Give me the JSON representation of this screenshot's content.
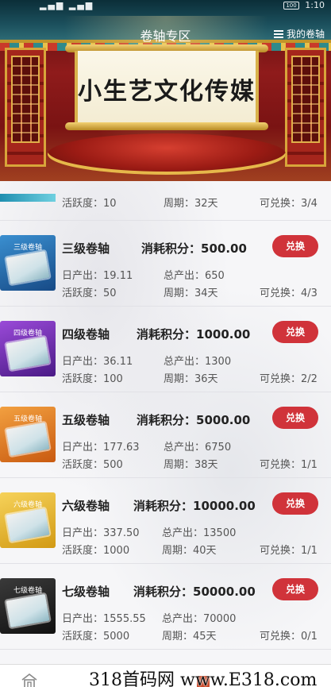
{
  "status_bar": {
    "time": "1:10",
    "battery": "100"
  },
  "header": {
    "title": "卷轴专区",
    "my_scroll": "我的卷轴"
  },
  "banner": {
    "scroll_title": "小生艺文化传媒"
  },
  "labels": {
    "daily": "日产出：",
    "total": "总产出：",
    "activity": "活跃度：",
    "period": "周期：",
    "exchangeable": "可兑换：",
    "cost": "消耗积分："
  },
  "partial_row": {
    "activity": "10",
    "period": "32天",
    "exchangeable": "3/4"
  },
  "items": [
    {
      "name": "三级卷轴",
      "thumb_label": "三级卷轴",
      "thumb_color": "#2a6fb0",
      "cost": "500.00",
      "button": "兑换",
      "daily": "19.11",
      "total": "650",
      "activity": "50",
      "period": "34天",
      "exchangeable": "4/3"
    },
    {
      "name": "四级卷轴",
      "thumb_label": "四级卷轴",
      "thumb_color": "#6a2aa8",
      "cost": "1000.00",
      "button": "兑换",
      "daily": "36.11",
      "total": "1300",
      "activity": "100",
      "period": "36天",
      "exchangeable": "2/2"
    },
    {
      "name": "五级卷轴",
      "thumb_label": "五级卷轴",
      "thumb_color": "#e07820",
      "cost": "5000.00",
      "button": "兑换",
      "daily": "177.63",
      "total": "6750",
      "activity": "500",
      "period": "38天",
      "exchangeable": "1/1"
    },
    {
      "name": "六级卷轴",
      "thumb_label": "六级卷轴",
      "thumb_color": "#e3b62c",
      "cost": "10000.00",
      "button": "兑换",
      "daily": "337.50",
      "total": "13500",
      "activity": "1000",
      "period": "40天",
      "exchangeable": "1/1"
    },
    {
      "name": "七级卷轴",
      "thumb_label": "七级卷轴",
      "thumb_color": "#1e1e1e",
      "cost": "50000.00",
      "button": "兑换",
      "daily": "1555.55",
      "total": "70000",
      "activity": "5000",
      "period": "45天",
      "exchangeable": "0/1"
    }
  ],
  "watermark": "318首码网 www.E318.com"
}
